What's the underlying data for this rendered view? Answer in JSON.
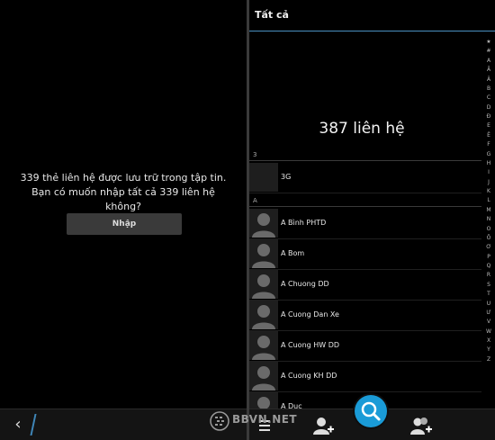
{
  "left": {
    "prompt": "339 thẻ liên hệ được lưu trữ trong tập tin. Bạn có muốn nhập tất cả 339 liên hệ không?",
    "import_label": "Nhập"
  },
  "right": {
    "title": "Tất cả",
    "count": "387 liên hệ",
    "sections": [
      {
        "label": "3",
        "contacts": [
          "3G"
        ]
      },
      {
        "label": "A",
        "contacts": [
          "A Bình PHTD",
          "A Bom",
          "A Chuong DD",
          "A Cuong Dan Xe",
          "A Cuong HW DD",
          "A Cuong KH DD",
          "A Duc"
        ]
      }
    ],
    "index": [
      "★",
      "#",
      "A",
      "Ă",
      "Â",
      "B",
      "C",
      "D",
      "Đ",
      "E",
      "Ê",
      "F",
      "G",
      "H",
      "I",
      "J",
      "K",
      "L",
      "M",
      "N",
      "O",
      "Ô",
      "Ơ",
      "P",
      "Q",
      "R",
      "S",
      "T",
      "U",
      "Ư",
      "V",
      "W",
      "X",
      "Y",
      "Z"
    ]
  },
  "watermark": "BBVN.NET",
  "accent_color": "#1a9bd7"
}
